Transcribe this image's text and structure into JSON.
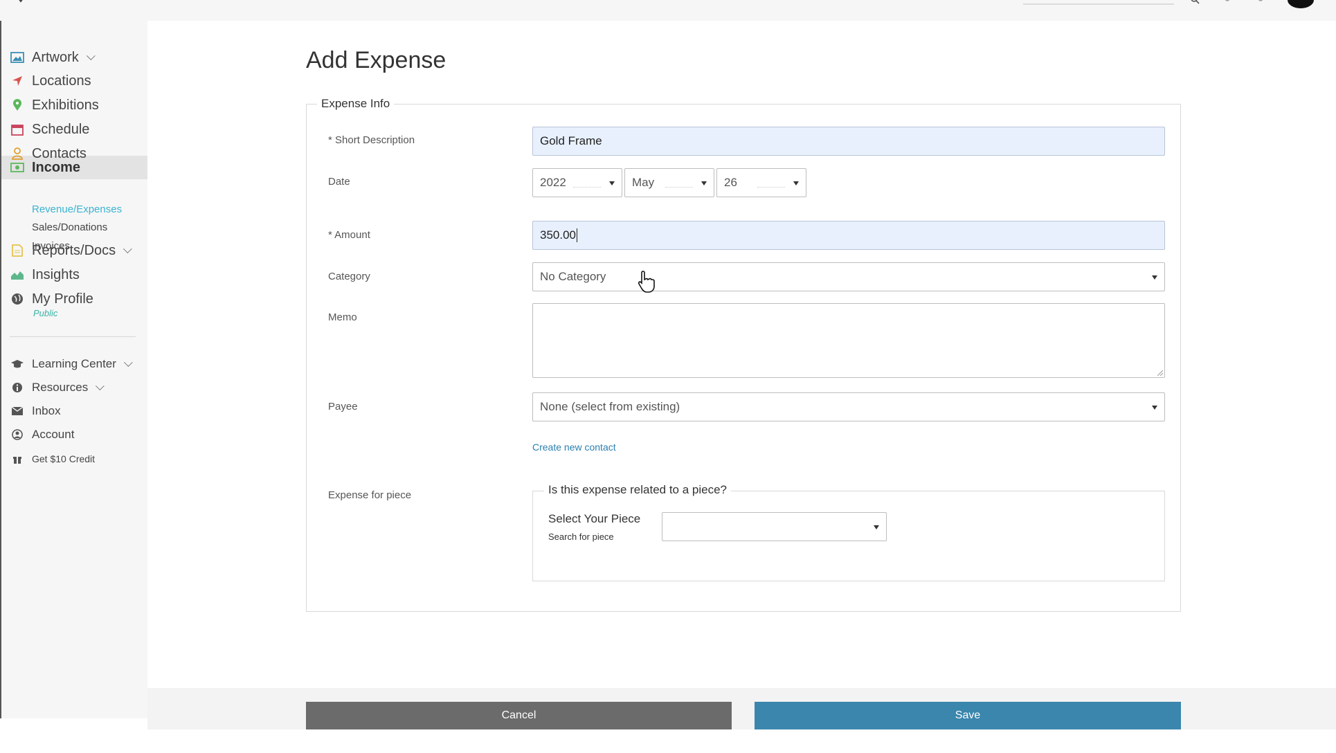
{
  "sidebar": {
    "items": [
      {
        "label": "Artwork",
        "icon": "image-icon",
        "color": "#3b8fb5"
      },
      {
        "label": "Locations",
        "icon": "location-arrow-icon",
        "color": "#d9534f"
      },
      {
        "label": "Exhibitions",
        "icon": "map-pin-icon",
        "color": "#5cb85c"
      },
      {
        "label": "Schedule",
        "icon": "calendar-icon",
        "color": "#c9455c"
      },
      {
        "label": "Contacts",
        "icon": "person-icon",
        "color": "#e0a030"
      },
      {
        "label": "Income",
        "icon": "money-icon",
        "color": "#5cb85c"
      },
      {
        "label": "Reports/Docs",
        "icon": "document-icon",
        "color": "#e6c250"
      },
      {
        "label": "Insights",
        "icon": "area-chart-icon",
        "color": "#5cb88c"
      },
      {
        "label": "My Profile",
        "icon": "globe-icon",
        "color": "#555555"
      }
    ],
    "income_sub": [
      "Revenue/Expenses",
      "Sales/Donations",
      "Invoices"
    ],
    "profile_tag": "Public",
    "secondary": [
      {
        "label": "Learning Center",
        "icon": "graduation-cap-icon"
      },
      {
        "label": "Resources",
        "icon": "info-icon"
      },
      {
        "label": "Inbox",
        "icon": "envelope-icon"
      },
      {
        "label": "Account",
        "icon": "user-circle-icon"
      },
      {
        "label": "Get $10 Credit",
        "icon": "gift-icon"
      }
    ]
  },
  "page": {
    "title": "Add Expense"
  },
  "form": {
    "legend": "Expense Info",
    "labels": {
      "short_description": "* Short Description",
      "date": "Date",
      "amount": "* Amount",
      "category": "Category",
      "memo": "Memo",
      "payee": "Payee",
      "expense_for_piece": "Expense for piece"
    },
    "short_description": "Gold Frame",
    "date": {
      "year": "2022",
      "month": "May",
      "day": "26"
    },
    "amount": "350.00",
    "category": "No Category",
    "memo": "",
    "payee": "None (select from existing)",
    "create_contact": "Create new contact",
    "piece": {
      "legend": "Is this expense related to a piece?",
      "label": "Select Your Piece",
      "sub": "Search for piece",
      "value": ""
    }
  },
  "footer": {
    "cancel": "Cancel",
    "save": "Save"
  },
  "colors": {
    "save": "#3a86ad",
    "cancel": "#6b6b6b",
    "active_link": "#3bb3d1",
    "input_fill": "#e8f0fe"
  }
}
